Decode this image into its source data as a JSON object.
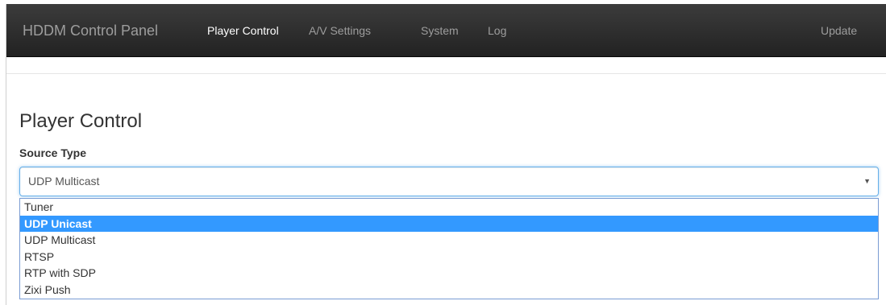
{
  "navbar": {
    "brand": "HDDM Control Panel",
    "items": [
      {
        "label": "Player Control",
        "active": true
      },
      {
        "label": "A/V Settings",
        "active": false
      },
      {
        "label": "System",
        "active": false
      },
      {
        "label": "Log",
        "active": false
      }
    ],
    "right_item": "Update"
  },
  "main": {
    "title": "Player Control",
    "source_type": {
      "label": "Source Type",
      "value": "UDP Multicast",
      "caret_icon": "caret-down-icon",
      "options": [
        {
          "label": "Tuner",
          "highlighted": false
        },
        {
          "label": "UDP Unicast",
          "highlighted": true
        },
        {
          "label": "UDP Multicast",
          "highlighted": false
        },
        {
          "label": "RTSP",
          "highlighted": false
        },
        {
          "label": "RTP with SDP",
          "highlighted": false
        },
        {
          "label": "Zixi Push",
          "highlighted": false
        }
      ]
    }
  },
  "colors": {
    "navbar_bg": "#222222",
    "nav_text": "#9d9d9d",
    "nav_active": "#ffffff",
    "focus_border": "#66afe9",
    "highlight": "#3399ff"
  }
}
